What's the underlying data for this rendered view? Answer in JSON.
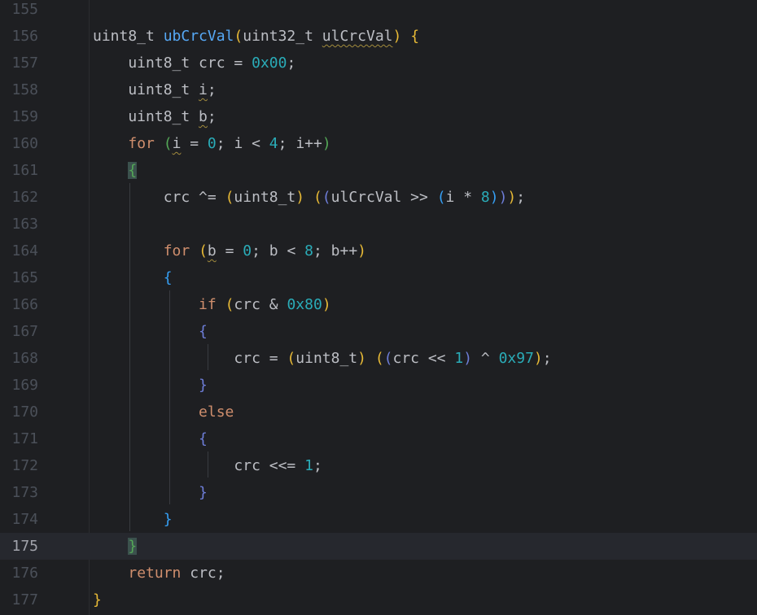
{
  "editor": {
    "current_line": 175,
    "lines": [
      {
        "n": 155,
        "segs": []
      },
      {
        "n": 156,
        "segs": [
          [
            "uint8_t ",
            ""
          ],
          [
            "ubCrcVal",
            "fn"
          ],
          [
            "(",
            "p1"
          ],
          [
            "uint32_t ",
            ""
          ],
          [
            "ulCrcVal",
            "warn"
          ],
          [
            ")",
            "p1"
          ],
          [
            " ",
            ""
          ],
          [
            "{",
            "p1"
          ]
        ]
      },
      {
        "n": 157,
        "segs": [
          [
            "    uint8_t crc = ",
            ""
          ],
          [
            "0x00",
            "num"
          ],
          [
            ";",
            ""
          ]
        ]
      },
      {
        "n": 158,
        "segs": [
          [
            "    uint8_t ",
            ""
          ],
          [
            "i",
            "warn"
          ],
          [
            ";",
            ""
          ]
        ]
      },
      {
        "n": 159,
        "segs": [
          [
            "    uint8_t ",
            ""
          ],
          [
            "b",
            "warn"
          ],
          [
            ";",
            ""
          ]
        ]
      },
      {
        "n": 160,
        "segs": [
          [
            "    ",
            ""
          ],
          [
            "for",
            "kw"
          ],
          [
            " ",
            ""
          ],
          [
            "(",
            "p2"
          ],
          [
            "i",
            "warn"
          ],
          [
            " = ",
            ""
          ],
          [
            "0",
            "num"
          ],
          [
            "; i < ",
            ""
          ],
          [
            "4",
            "num"
          ],
          [
            "; i++",
            ""
          ],
          [
            ")",
            "p2"
          ]
        ]
      },
      {
        "n": 161,
        "segs": [
          [
            "    ",
            ""
          ],
          [
            "{",
            "p2 hl"
          ]
        ]
      },
      {
        "n": 162,
        "segs": [
          [
            "        crc ^= ",
            ""
          ],
          [
            "(",
            "p1"
          ],
          [
            "uint8_t",
            ""
          ],
          [
            ")",
            "p1"
          ],
          [
            " ",
            ""
          ],
          [
            "(",
            "p1"
          ],
          [
            "(",
            "p4"
          ],
          [
            "ulCrcVal >> ",
            ""
          ],
          [
            "(",
            "p3"
          ],
          [
            "i * ",
            ""
          ],
          [
            "8",
            "num"
          ],
          [
            ")",
            "p3"
          ],
          [
            ")",
            "p4"
          ],
          [
            ")",
            "p1"
          ],
          [
            ";",
            ""
          ]
        ]
      },
      {
        "n": 163,
        "segs": []
      },
      {
        "n": 164,
        "segs": [
          [
            "        ",
            ""
          ],
          [
            "for",
            "kw"
          ],
          [
            " ",
            ""
          ],
          [
            "(",
            "p1"
          ],
          [
            "b",
            "warn"
          ],
          [
            " = ",
            ""
          ],
          [
            "0",
            "num"
          ],
          [
            "; b < ",
            ""
          ],
          [
            "8",
            "num"
          ],
          [
            "; b++",
            ""
          ],
          [
            ")",
            "p1"
          ]
        ]
      },
      {
        "n": 165,
        "segs": [
          [
            "        ",
            ""
          ],
          [
            "{",
            "p3"
          ]
        ]
      },
      {
        "n": 166,
        "segs": [
          [
            "            ",
            ""
          ],
          [
            "if",
            "kw"
          ],
          [
            " ",
            ""
          ],
          [
            "(",
            "p1"
          ],
          [
            "crc & ",
            ""
          ],
          [
            "0x80",
            "num"
          ],
          [
            ")",
            "p1"
          ]
        ]
      },
      {
        "n": 167,
        "segs": [
          [
            "            ",
            ""
          ],
          [
            "{",
            "p4"
          ]
        ]
      },
      {
        "n": 168,
        "segs": [
          [
            "                crc = ",
            ""
          ],
          [
            "(",
            "p1"
          ],
          [
            "uint8_t",
            ""
          ],
          [
            ")",
            "p1"
          ],
          [
            " ",
            ""
          ],
          [
            "(",
            "p1"
          ],
          [
            "(",
            "p4"
          ],
          [
            "crc << ",
            ""
          ],
          [
            "1",
            "num"
          ],
          [
            ")",
            "p4"
          ],
          [
            " ^ ",
            ""
          ],
          [
            "0x97",
            "num"
          ],
          [
            ")",
            "p1"
          ],
          [
            ";",
            ""
          ]
        ]
      },
      {
        "n": 169,
        "segs": [
          [
            "            ",
            ""
          ],
          [
            "}",
            "p4"
          ]
        ]
      },
      {
        "n": 170,
        "segs": [
          [
            "            ",
            ""
          ],
          [
            "else",
            "kw"
          ]
        ]
      },
      {
        "n": 171,
        "segs": [
          [
            "            ",
            ""
          ],
          [
            "{",
            "p4"
          ]
        ]
      },
      {
        "n": 172,
        "segs": [
          [
            "                crc <<= ",
            ""
          ],
          [
            "1",
            "num"
          ],
          [
            ";",
            ""
          ]
        ]
      },
      {
        "n": 173,
        "segs": [
          [
            "            ",
            ""
          ],
          [
            "}",
            "p4"
          ]
        ]
      },
      {
        "n": 174,
        "segs": [
          [
            "        ",
            ""
          ],
          [
            "}",
            "p3"
          ]
        ]
      },
      {
        "n": 175,
        "segs": [
          [
            "    ",
            ""
          ],
          [
            "}",
            "p2 hl"
          ]
        ]
      },
      {
        "n": 176,
        "segs": [
          [
            "    ",
            ""
          ],
          [
            "return",
            "kw"
          ],
          [
            " crc;",
            ""
          ]
        ]
      },
      {
        "n": 177,
        "segs": [
          [
            "}",
            "p1"
          ]
        ]
      }
    ]
  }
}
